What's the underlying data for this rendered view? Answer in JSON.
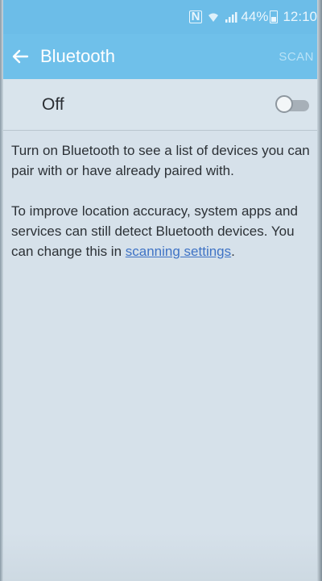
{
  "status_bar": {
    "nfc": "N",
    "battery": "44%",
    "time": "12:10"
  },
  "header": {
    "title": "Bluetooth",
    "scan_label": "SCAN"
  },
  "bluetooth_toggle": {
    "label": "Off",
    "state": false
  },
  "info": {
    "paragraph1": "Turn on Bluetooth to see a list of devices you can pair with or have already paired with.",
    "paragraph2_text": "To improve location accuracy, system apps and services can still detect Bluetooth devices. You can change this in ",
    "paragraph2_link": "scanning settings",
    "paragraph2_end": "."
  },
  "colors": {
    "app_bar": "#6fc0ea",
    "background": "#d6e1ea",
    "link": "#3f73c5"
  }
}
